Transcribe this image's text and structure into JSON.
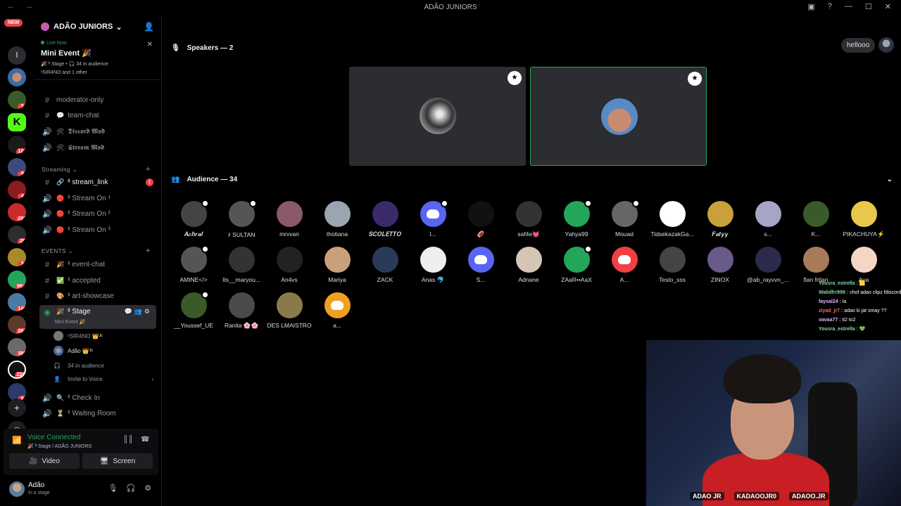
{
  "window": {
    "title": "ADÃO JUNIORS",
    "nav": "← →"
  },
  "rail": {
    "new_label": "NEW",
    "badges": [
      "5",
      "124",
      "9",
      "4",
      "282",
      "25",
      "5",
      "9K+",
      "148",
      "282",
      "388",
      "224",
      "6"
    ]
  },
  "server": {
    "name": "ADÃO JUNIORS"
  },
  "event": {
    "live": "Live Now",
    "title": "Mini Event 🎉",
    "line1": "🎉 ᴵᴵ Stage • 🎧 34 in audience",
    "line2": "ˢSIR4NO and 1 other"
  },
  "channels": [
    {
      "name": "moderator-only",
      "icon": "#",
      "emoji": ""
    },
    {
      "name": "team-chat",
      "icon": "#",
      "emoji": "💬"
    },
    {
      "name": "𝕯𝖎𝖘𝖈𝖔𝖗𝖉 𝕸𝖔𝖉",
      "icon": "🔊",
      "emoji": "🛠"
    },
    {
      "name": "𝕾𝖙𝖗𝖊𝖆𝖒 𝕸𝖔𝖉",
      "icon": "🔊",
      "emoji": "🛠"
    }
  ],
  "cat_streaming": "Streaming",
  "streaming": [
    {
      "name": "ᴵᴵ stream_link",
      "icon": "#",
      "emoji": "🔗",
      "badge": "1"
    },
    {
      "name": "ᴵᴵ Stream On ¹",
      "icon": "🔊",
      "emoji": "🔴"
    },
    {
      "name": "ᴵᴵ Stream On ²",
      "icon": "🔊",
      "emoji": "🔴"
    },
    {
      "name": "ᴵᴵ Stream On ³",
      "icon": "🔊",
      "emoji": "🔴"
    }
  ],
  "cat_events": "EVENTS",
  "events": [
    {
      "name": "ᴵᴵ event-chat",
      "icon": "#",
      "emoji": "🎉"
    },
    {
      "name": "ᴵᴵ accepted",
      "icon": "#",
      "emoji": "✅"
    },
    {
      "name": "ᴵᴵ art-showcase",
      "icon": "#",
      "emoji": "🎨"
    }
  ],
  "stage": {
    "name": "ᴵᴵ Stage",
    "sub": "Mini Event 🎉",
    "speaker1": "ˢSIR4NO",
    "speaker2": "Adão",
    "tag": "👑ᴶᶜ",
    "audience": "34 in audience",
    "invite": "Invite to Voice"
  },
  "lower": [
    {
      "name": "ᴵᴵ Check In",
      "icon": "🔊",
      "emoji": "🔍"
    },
    {
      "name": "ᴵᴵ Waiting Room",
      "icon": "🔊",
      "emoji": "⏳"
    }
  ],
  "voice": {
    "status": "Voice Connected",
    "location": "🎉 ᴵᴵ Stage / ADÃO JUNIORS",
    "video": "Video",
    "screen": "Screen"
  },
  "user": {
    "name": "Adão",
    "status": "In a stage"
  },
  "speakers_header": "Speakers — 2",
  "audience_header": "Audience — 34",
  "hello_text": "hellooo",
  "audience": [
    [
      "𝑨𝒄𝒉𝒓𝒂𝒇",
      "ﾒ SULTAN",
      "mrvvan",
      "thotiana",
      "𝑺𝑪𝑶𝑳𝑬𝑻𝑻𝑶",
      "l...",
      "🏈",
      "saf4e💓",
      "Yahya99",
      "Mouad",
      "TidsekazakGa...",
      "𝑭𝒂𝒕𝒚𝒚",
      "s...",
      "K...",
      "PIKACHUYA⚡"
    ],
    [
      "AMINE</>",
      "Its__maryou...",
      "An4vs",
      "Mariya",
      "ZACK",
      "Anas 🐬",
      "S...",
      "Adnane",
      "ZAaR••AaX",
      "A...",
      "Testo_sss",
      "ZINOX",
      "@ab_rayvvn_...",
      "flan frtlan",
      "Aya"
    ],
    [
      "__Youssef_UE",
      "Ranita 🌸🌸",
      "DES LMAISTRO",
      "a..."
    ]
  ],
  "chat": [
    {
      "user": "Yousra_estrella :",
      "msg": "🟨",
      "color": "#7fd6a6"
    },
    {
      "user": "Walidfrr999 :",
      "msg": "chof adao clipz fdiscord",
      "color": "#7fd6a6"
    },
    {
      "user": "faysal24 :",
      "msg": "la",
      "color": "#e3b7ff"
    },
    {
      "user": "ziyad_jr7 :",
      "msg": "adao ki jat smay ??",
      "color": "#ff6b6b"
    },
    {
      "user": "vavaa77 :",
      "msg": "ti2 to2",
      "color": "#e3b7ff"
    },
    {
      "user": "Yousra_estrella :",
      "msg": "💚",
      "color": "#7fd6a6"
    }
  ],
  "socials": [
    "ADAO JR",
    "KADAOOJR0",
    "ADAOO.JR"
  ]
}
